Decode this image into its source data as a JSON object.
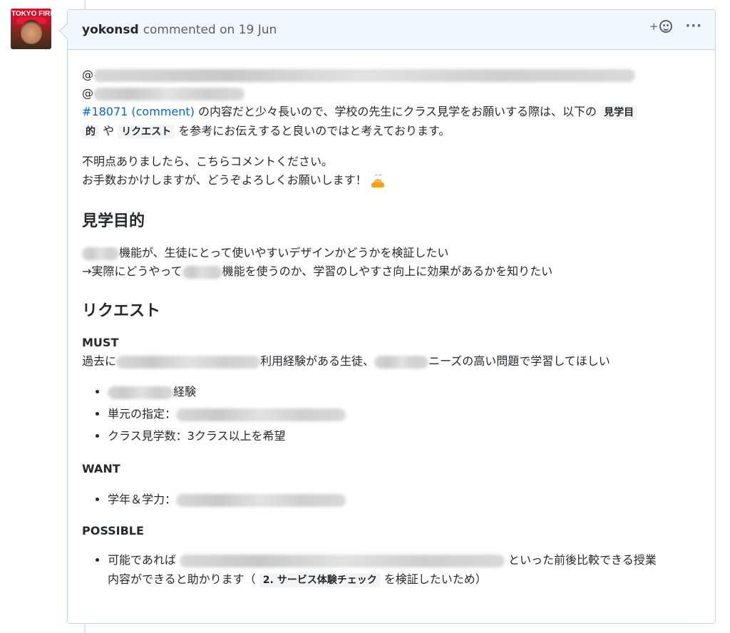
{
  "avatar": {
    "banner_text": "TOKYO FIRE"
  },
  "comment": {
    "author": "yokonsd",
    "meta": "commented on 19 Jun",
    "reaction_plus": "+",
    "more_label": "···"
  },
  "body": {
    "mention1_at": "@",
    "mention2_at": "@",
    "issue_link": "#18071 (comment)",
    "intro_a": " の内容だと少々長いので、学校の先生にクラス見学をお願いする際は、以下の ",
    "intro_code1a": "見学目",
    "intro_code1b": "的",
    "intro_b": " や ",
    "intro_code2": "リクエスト",
    "intro_c": " を参考にお伝えすると良いのではと考えております。",
    "para2_line1": "不明点ありましたら、こちらコメントください。",
    "para2_line2": "お手数おかけしますが、どうぞよろしくお願いします！",
    "h_purpose": "見学目的",
    "purpose_line1": "機能が、生徒にとって使いやすいデザインかどうかを検証したい",
    "purpose_line2a": "→実際にどうやって",
    "purpose_line2b": "機能を使うのか、学習のしやすさ向上に効果があるかを知りたい",
    "h_request": "リクエスト",
    "must_label": "MUST",
    "must_line_a": "過去に",
    "must_line_b": "利用経験がある生徒、",
    "must_line_c": "ニーズの高い問題で学習してほしい",
    "must_items": [
      "経験",
      "単元の指定：",
      "クラス見学数：3クラス以上を希望"
    ],
    "want_label": "WANT",
    "want_items": [
      "学年＆学力："
    ],
    "possible_label": "POSSIBLE",
    "possible_a": "可能であれば",
    "possible_b": "といった前後比較できる授業",
    "possible_c": "内容ができると助かります（ ",
    "possible_code": "2. サービス体験チェック",
    "possible_d": " を検証したいため）"
  }
}
